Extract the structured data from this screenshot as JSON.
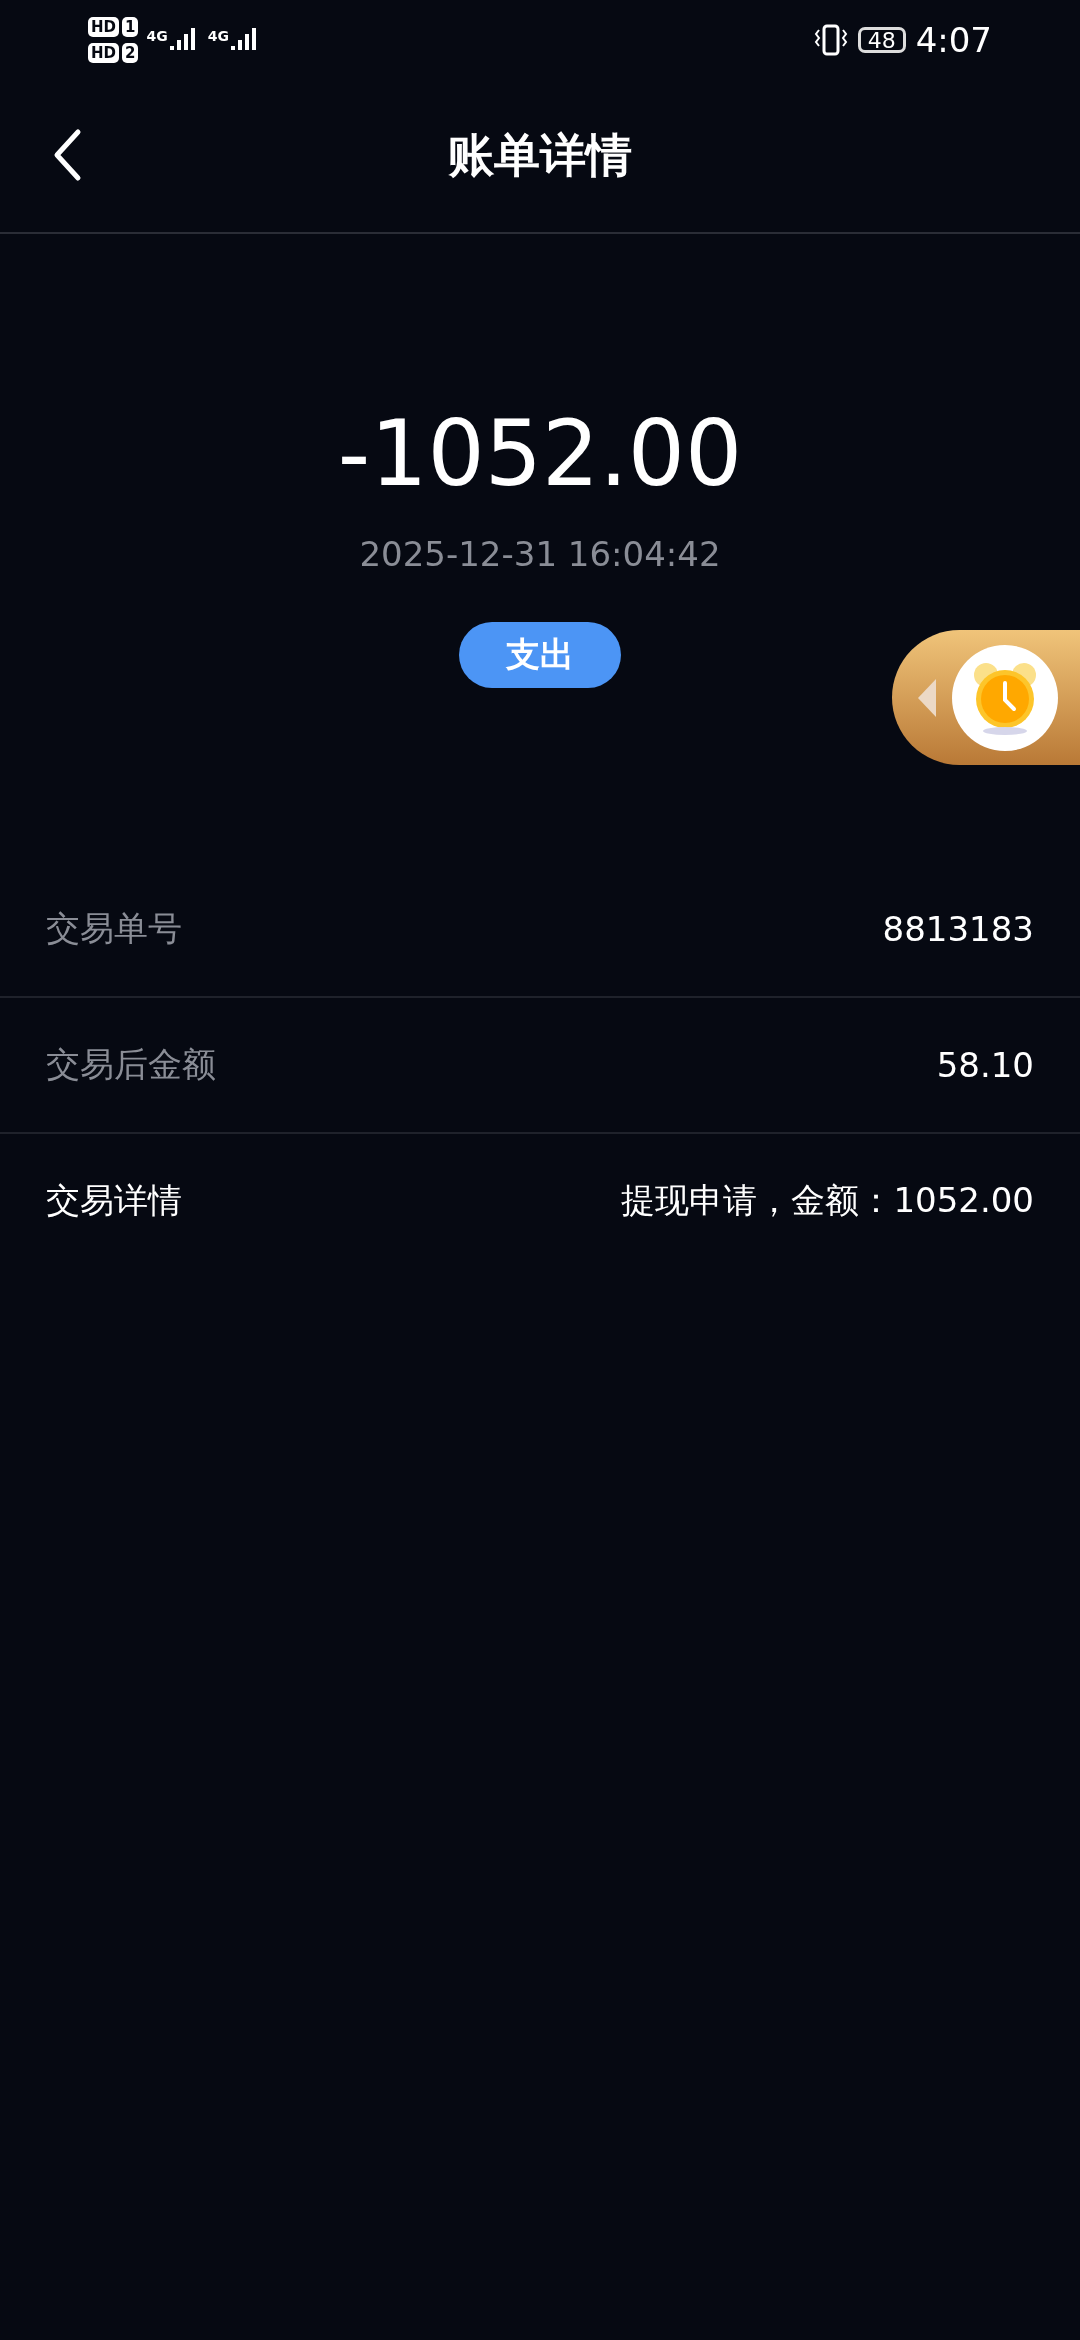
{
  "status_bar": {
    "sim_1": {
      "badge": "HD",
      "slot": "1",
      "network": "4G"
    },
    "sim_2": {
      "badge": "HD",
      "slot": "2",
      "network": "4G"
    },
    "battery": "48",
    "time": "4:07"
  },
  "header": {
    "title": "账单详情"
  },
  "summary": {
    "amount": "-1052.00",
    "datetime": "2025-12-31 16:04:42",
    "type_badge": "支出"
  },
  "rows": [
    {
      "label": "交易单号",
      "value": "8813183",
      "emphasized": false
    },
    {
      "label": "交易后金额",
      "value": "58.10",
      "emphasized": false
    },
    {
      "label": "交易详情",
      "value": "提现申请，金额：1052.00",
      "emphasized": true
    }
  ]
}
